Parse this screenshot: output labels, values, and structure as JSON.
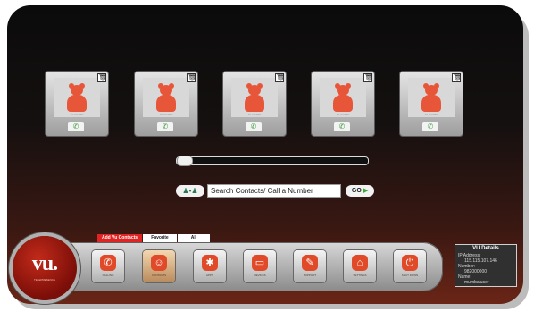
{
  "contacts": [
    {
      "name": "Vu Contact",
      "delete_icon": "trash-icon",
      "call_icon": "phone-icon"
    },
    {
      "name": "Vu Contact",
      "delete_icon": "trash-icon",
      "call_icon": "phone-icon"
    },
    {
      "name": "Vu Contact",
      "delete_icon": "trash-icon",
      "call_icon": "phone-icon"
    },
    {
      "name": "Vu Contact",
      "delete_icon": "trash-icon",
      "call_icon": "phone-icon"
    },
    {
      "name": "Vu Contact",
      "delete_icon": "trash-icon",
      "call_icon": "phone-icon"
    }
  ],
  "slider": {
    "value": 0.03
  },
  "search": {
    "placeholder": "Search Contacts/ Call a Number",
    "value": "Search Contacts/ Call a Number",
    "go_label": "GO",
    "go_arrow": "▶",
    "icon_glyph": "♟•♟"
  },
  "tabs": [
    {
      "label": "Add Vu Contacts",
      "active": true
    },
    {
      "label": "Favorite",
      "active": false
    },
    {
      "label": "All",
      "active": false
    }
  ],
  "logo": {
    "text": "vu.",
    "subtitle": "TELEPRESENCE"
  },
  "dock": [
    {
      "label": "CALLING",
      "icon": "phone-icon",
      "glyph": "✆"
    },
    {
      "label": "CONTACTS",
      "icon": "contacts-icon",
      "glyph": "☺"
    },
    {
      "label": "APPS",
      "icon": "apps-icon",
      "glyph": "✱"
    },
    {
      "label": "DEVICES",
      "icon": "device-icon",
      "glyph": "▭"
    },
    {
      "label": "SUPPORT",
      "icon": "support-icon",
      "glyph": "✎"
    },
    {
      "label": "SETTINGS",
      "icon": "settings-icon",
      "glyph": "⌂"
    },
    {
      "label": "SHUT DOWN",
      "icon": "power-icon",
      "glyph": "⏻"
    }
  ],
  "vu_details": {
    "title": "VU Details",
    "ip_label": "IP Address:",
    "ip_value": "115.115.107.146",
    "number_label": "Number:",
    "number_value": "982000000",
    "name_label": "Name:",
    "name_value": "mumbaiuser"
  },
  "colors": {
    "accent": "#e02424",
    "avatar": "#e8563a",
    "call_green": "#3a9a3a"
  }
}
